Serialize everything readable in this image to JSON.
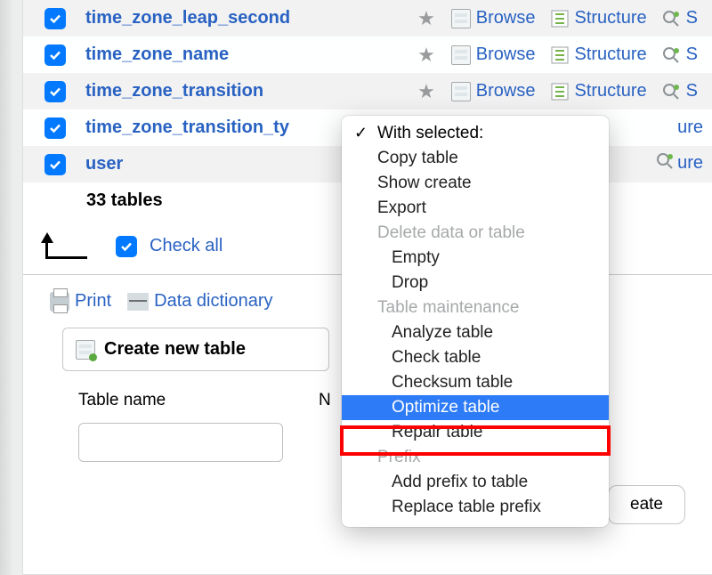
{
  "tables": {
    "rows": [
      {
        "name": "time_zone_leap_second"
      },
      {
        "name": "time_zone_name"
      },
      {
        "name": "time_zone_transition"
      },
      {
        "name": "time_zone_transition_ty"
      },
      {
        "name": "user"
      }
    ],
    "summary": "33 tables"
  },
  "actions": {
    "browse": "Browse",
    "structure": "Structure",
    "search": "S"
  },
  "checkall": {
    "label": "Check all"
  },
  "utils": {
    "print": "Print",
    "dictionary": "Data dictionary"
  },
  "create": {
    "heading": "Create new table",
    "table_name_label": "Table name",
    "cols_label": "N",
    "submit": "eate"
  },
  "menu": {
    "header": "With selected:",
    "items_top": [
      "Copy table",
      "Show create",
      "Export"
    ],
    "group_delete": {
      "label": "Delete data or table",
      "items": [
        "Empty",
        "Drop"
      ]
    },
    "group_maint": {
      "label": "Table maintenance",
      "items": [
        "Analyze table",
        "Check table",
        "Checksum table",
        "Optimize table",
        "Repair table"
      ],
      "selected_index": 3
    },
    "group_prefix": {
      "label": "Prefix",
      "items": [
        "Add prefix to table",
        "Replace table prefix"
      ]
    }
  }
}
